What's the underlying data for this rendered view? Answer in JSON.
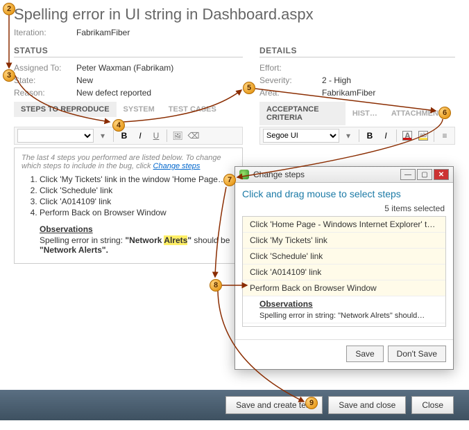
{
  "title": "Spelling error in UI string in Dashboard.aspx",
  "iteration": {
    "label": "Iteration:",
    "value": "FabrikamFiber"
  },
  "status": {
    "heading": "STATUS",
    "fields": {
      "assigned_to": {
        "label": "Assigned To:",
        "value": "Peter Waxman (Fabrikam)"
      },
      "state": {
        "label": "State:",
        "value": "New"
      },
      "reason": {
        "label": "Reason:",
        "value": "New defect reported"
      }
    }
  },
  "details": {
    "heading": "DETAILS",
    "fields": {
      "effort": {
        "label": "Effort:",
        "value": ""
      },
      "severity": {
        "label": "Severity:",
        "value": "2 - High"
      },
      "area": {
        "label": "Area:",
        "value": "FabrikamFiber"
      }
    }
  },
  "tabs_left": {
    "steps": "STEPS TO REPRODUCE",
    "system": "SYSTEM",
    "testcases": "TEST CASES"
  },
  "tabs_right": {
    "acceptance": "ACCEPTANCE CRITERIA",
    "hist": "HIST…",
    "attachments": "ATTACHMENTS"
  },
  "toolbar_left": {
    "block_select": "",
    "b": "B",
    "i": "I",
    "u": "U"
  },
  "toolbar_right": {
    "font": "Segoe UI",
    "b": "B",
    "i": "I",
    "a_label": "A"
  },
  "colors": {
    "font_red": "#d01414",
    "highlight_yellow": "#ffe14a"
  },
  "steps_box": {
    "intro_prefix": "The last 4 steps you performed are listed below. To change which steps to include in the bug, click ",
    "intro_link": "Change steps",
    "items": [
      "Click 'My Tickets' link in the window 'Home Page…",
      "Click 'Schedule' link",
      "Click 'A014109' link",
      "Perform Back on Browser Window"
    ],
    "obs_heading": "Observations",
    "obs_line1_a": "Spelling error in string: ",
    "obs_line1_q1": "\"Network ",
    "obs_line1_hl": "Alrets",
    "obs_line1_q2": "\"",
    "obs_line1_b": " should be ",
    "obs_line2": "\"Network Alerts\"."
  },
  "modal": {
    "title": "Change steps",
    "message": "Click and drag mouse to select steps",
    "selected_count": "5 items selected",
    "rows": [
      "Click 'Home Page - Windows Internet Explorer' t…",
      "Click 'My Tickets' link",
      "Click 'Schedule' link",
      "Click 'A014109' link",
      "Perform Back on Browser Window"
    ],
    "obs_heading": "Observations",
    "obs_line": "Spelling error in string: \"Network Alrets\" should…",
    "save": "Save",
    "dont_save": "Don't Save"
  },
  "bottom": {
    "save_create_test": "Save and create test",
    "save_close": "Save and close",
    "close": "Close"
  },
  "callouts": {
    "2": "2",
    "3": "3",
    "4": "4",
    "5": "5",
    "6": "6",
    "7": "7",
    "8": "8",
    "9": "9"
  }
}
